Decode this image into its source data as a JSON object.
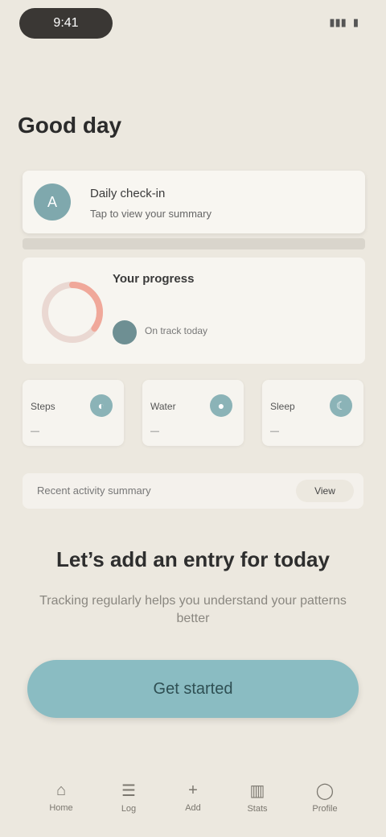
{
  "status_bar": {
    "pill_label": "9:41",
    "indicators": [
      "▮▮▮",
      "▮"
    ]
  },
  "header": {
    "title": "Good day"
  },
  "card_primary": {
    "avatar_letter": "A",
    "title": "Daily check‑in",
    "subtitle": "Tap to view your summary"
  },
  "card_progress": {
    "title": "Your progress",
    "note": "On track today",
    "progress_fraction": 0.35
  },
  "quick_cards": [
    {
      "label": "Steps",
      "value": "—",
      "icon": "walk-icon"
    },
    {
      "label": "Water",
      "value": "—",
      "icon": "drop-icon"
    },
    {
      "label": "Sleep",
      "value": "—",
      "icon": "moon-icon"
    }
  ],
  "info_bar": {
    "text": "Recent activity summary",
    "button_label": "View"
  },
  "callout": {
    "heading": "Let’s add an entry for today",
    "subtext": "Tracking regularly helps you understand your patterns better"
  },
  "primary_button_label": "Get started",
  "nav": {
    "items": [
      {
        "label": "Home",
        "icon": "home-icon"
      },
      {
        "label": "Log",
        "icon": "list-icon"
      },
      {
        "label": "Add",
        "icon": "plus-icon"
      },
      {
        "label": "Stats",
        "icon": "chart-icon"
      },
      {
        "label": "Profile",
        "icon": "user-icon"
      }
    ]
  },
  "colors": {
    "background": "#ece8df",
    "accent": "#8abcc2",
    "progress": "#f0a89a"
  }
}
